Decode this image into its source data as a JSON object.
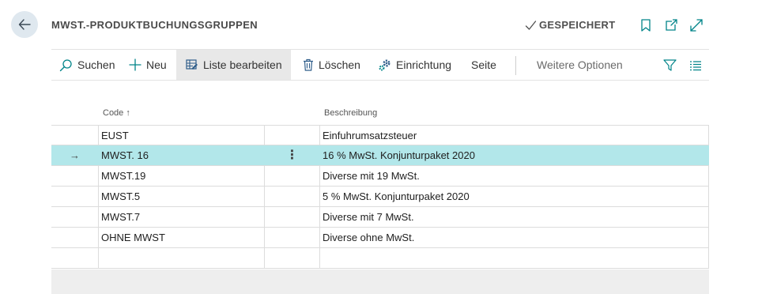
{
  "header": {
    "title": "MWST.-PRODUKTBUCHUNGSGRUPPEN",
    "saved_label": "GESPEICHERT"
  },
  "actions": {
    "search": "Suchen",
    "new": "Neu",
    "edit_list": "Liste bearbeiten",
    "delete": "Löschen",
    "setup": "Einrichtung",
    "page": "Seite",
    "more": "Weitere Optionen"
  },
  "columns": {
    "code": "Code ↑",
    "description": "Beschreibung"
  },
  "rows": [
    {
      "code": "EUST",
      "description": "Einfuhrumsatzsteuer",
      "selected": false
    },
    {
      "code": "MWST. 16",
      "description": "16 % MwSt. Konjunturpaket 2020",
      "selected": true,
      "indicator": "→",
      "menu": "⋮"
    },
    {
      "code": "MWST.19",
      "description": "Diverse mit 19 MwSt.",
      "selected": false
    },
    {
      "code": "MWST.5",
      "description": "5 % MwSt. Konjunturpaket 2020",
      "selected": false
    },
    {
      "code": "MWST.7",
      "description": "Diverse mit 7 MwSt.",
      "selected": false
    },
    {
      "code": "OHNE MWST",
      "description": "Diverse ohne MwSt.",
      "selected": false
    },
    {
      "code": "",
      "description": "",
      "selected": false
    }
  ],
  "colors": {
    "accent": "#008489",
    "selected_row": "#b2e7ea",
    "back_button": "#dfe8ef"
  },
  "icons": {
    "back": "arrow-left-icon",
    "saved": "checkmark-icon",
    "bookmark": "bookmark-icon",
    "share": "open-new-icon",
    "expand": "expand-icon",
    "search": "search-icon",
    "new": "plus-icon",
    "edit_list": "edit-list-icon",
    "delete": "trash-icon",
    "setup": "gear-icon",
    "filter": "filter-icon",
    "list_view": "list-view-icon"
  }
}
